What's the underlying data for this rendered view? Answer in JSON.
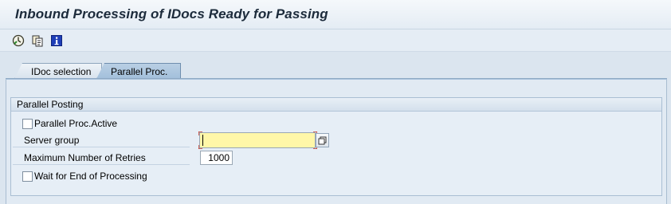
{
  "title": "Inbound Processing of IDocs Ready for Passing",
  "toolbar": {
    "buttons": [
      {
        "name": "execute-icon"
      },
      {
        "name": "variant-icon"
      },
      {
        "name": "info-icon"
      }
    ]
  },
  "tabs": [
    {
      "label": "IDoc selection",
      "active": false
    },
    {
      "label": "Parallel Proc.",
      "active": true
    }
  ],
  "group": {
    "title": "Parallel Posting",
    "parallel_active_label": "Parallel Proc.Active",
    "parallel_active_checked": false,
    "server_group_label": "Server group",
    "server_group_value": "",
    "max_retries_label": "Maximum Number of Retries",
    "max_retries_value": "1000",
    "wait_label": "Wait for End of Processing",
    "wait_checked": false
  },
  "colors": {
    "required_field": "#fff7a8",
    "active_tab": "#a2bfdb"
  }
}
